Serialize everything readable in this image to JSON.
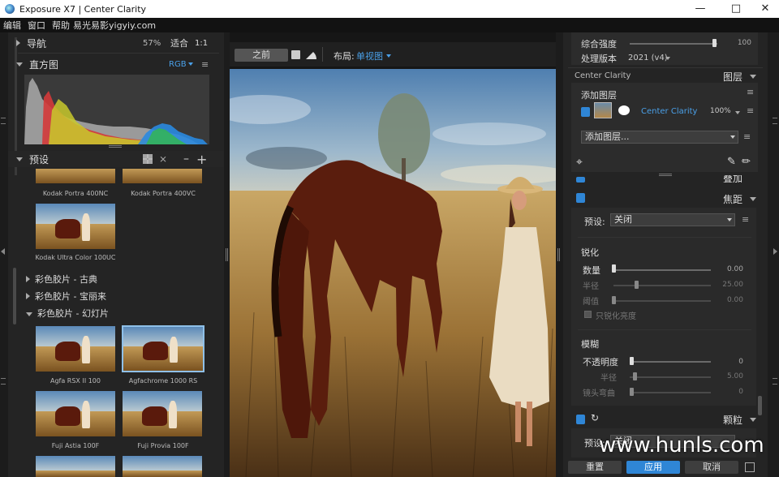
{
  "window": {
    "title": "Exposure X7 | Center Clarity"
  },
  "menu": {
    "items": [
      "编辑",
      "窗口",
      "帮助"
    ],
    "brand": "易光易影yigyiy.com"
  },
  "navigator": {
    "title": "导航",
    "zoom": "57%",
    "fit": "适合",
    "ratio": "1:1"
  },
  "histogram": {
    "title": "直方图",
    "mode": "RGB"
  },
  "presets": {
    "title": "预设",
    "top_labels": [
      "Kodak Portra 400NC",
      "Kodak Portra 400VC"
    ],
    "single_label": "Kodak Ultra Color 100UC",
    "folders": [
      "彩色胶片 - 古典",
      "彩色胶片 - 宝丽来",
      "彩色胶片 - 幻灯片"
    ],
    "grid_labels": [
      "Agfa RSX II 100",
      "Agfachrome 1000 RS",
      "Fuji Astia 100F",
      "Fuji Provia 100F"
    ]
  },
  "toolbar": {
    "before": "之前",
    "layout_label": "布局:",
    "layout_value": "单视图"
  },
  "right": {
    "strength_label": "综合强度",
    "strength_value": "100",
    "version_label": "处理版本",
    "version_value": "2021 (v4)",
    "layers_title": "Center Clarity",
    "layers_tab": "图层",
    "add_layer": "添加图层",
    "layer_name": "Center Clarity",
    "layer_opacity": "100%",
    "add_layer_dd": "添加图层...",
    "overlay_label": "叠加",
    "focus_title": "焦距",
    "preset_label": "预设:",
    "preset_value": "关闭",
    "sharpen_title": "锐化",
    "amount_label": "数量",
    "amount_value": "0.00",
    "radius_label": "半径",
    "radius_value": "25.00",
    "threshold_label": "阈值",
    "threshold_value": "0.00",
    "luma_only": "只锐化亮度",
    "blur_title": "模糊",
    "opacity_label": "不透明度",
    "opacity_value": "0",
    "blur_radius_label": "半径",
    "blur_radius_value": "5.00",
    "lens_label": "镜头弯曲",
    "lens_value": "0",
    "grain_title": "颗粒",
    "grain_preset_label": "预设:",
    "grain_preset_value": "关闭",
    "reset": "重置",
    "apply": "应用",
    "cancel": "取消"
  },
  "watermark": "www.hunls.com",
  "colors": {
    "accent": "#2f86d6",
    "panel": "#242424",
    "bg": "#1c1c1c"
  }
}
